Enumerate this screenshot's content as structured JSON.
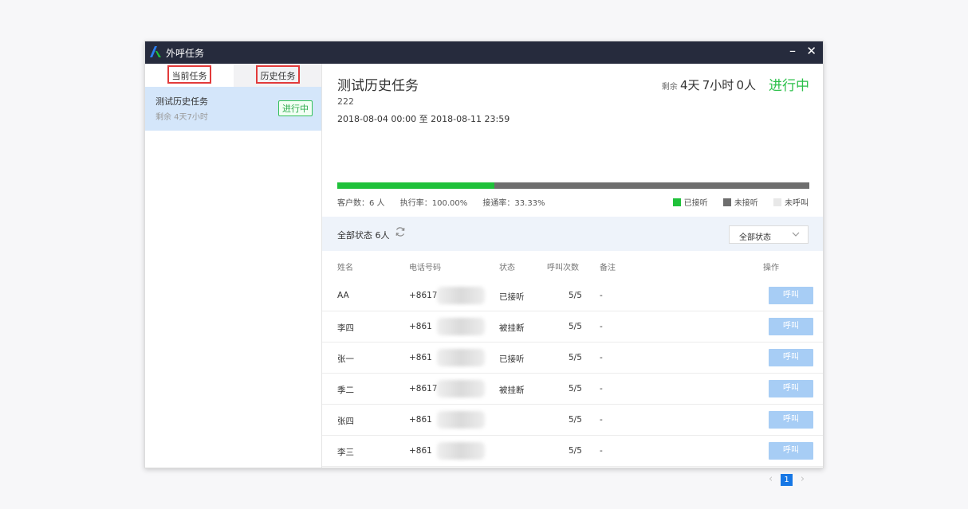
{
  "app": {
    "title": "外呼任务",
    "minimize_label": "–",
    "close_label": "✕",
    "logo_icon": "logo-icon",
    "accent": "#1fc13a"
  },
  "sidebar": {
    "tabs": [
      {
        "label": "当前任务"
      },
      {
        "label": "历史任务"
      }
    ],
    "task": {
      "name": "测试历史任务",
      "remaining": "剩余 4天7小时",
      "status": "进行中"
    }
  },
  "main": {
    "title": "测试历史任务",
    "code": "222",
    "date_range": "2018-08-04 00:00 至 2018-08-11 23:59",
    "remaining_label": "剩余",
    "remaining_days": "4天",
    "remaining_hours": "7小时",
    "remaining_people": "0人",
    "status": "进行中",
    "progress": {
      "answered_fraction": 0.3333
    },
    "stats": {
      "customers": "客户数：6 人",
      "execution_rate": "执行率：100.00%",
      "connect_rate": "接通率：33.33%"
    },
    "legend": [
      {
        "label": "已接听",
        "color": "#1fc13a"
      },
      {
        "label": "未接听",
        "color": "#6e6e6e"
      },
      {
        "label": "未呼叫",
        "color": "#e8e8e8"
      }
    ],
    "filter": {
      "label": "全部状态 6人",
      "select_value": "全部状态"
    },
    "table": {
      "headers": {
        "name": "姓名",
        "phone": "电话号码",
        "status": "状态",
        "calls": "呼叫次数",
        "note": "备注",
        "action": "操作"
      },
      "rows": [
        {
          "name": "AA",
          "phone": "+8617",
          "status": "已接听",
          "calls": "5/5",
          "note": "-",
          "action": "呼叫"
        },
        {
          "name": "李四",
          "phone": "+861",
          "status": "被挂断",
          "calls": "5/5",
          "note": "-",
          "action": "呼叫"
        },
        {
          "name": "张一",
          "phone": "+861",
          "status": "已接听",
          "calls": "5/5",
          "note": "-",
          "action": "呼叫"
        },
        {
          "name": "季二",
          "phone": "+8617",
          "status": "被挂断",
          "calls": "5/5",
          "note": "-",
          "action": "呼叫"
        },
        {
          "name": "张四",
          "phone": "+861",
          "status": "",
          "calls": "5/5",
          "note": "-",
          "action": "呼叫"
        },
        {
          "name": "李三",
          "phone": "+861",
          "status": "",
          "calls": "5/5",
          "note": "-",
          "action": "呼叫"
        }
      ]
    },
    "pagination": {
      "prev": "‹",
      "current": "1",
      "next": "›"
    }
  }
}
